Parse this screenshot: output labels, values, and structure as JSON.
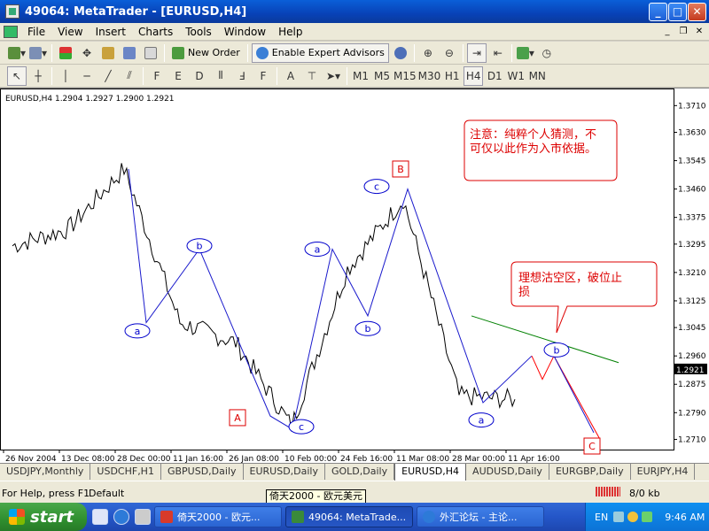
{
  "window": {
    "title": "49064: MetaTrader - [EURUSD,H4]"
  },
  "menu": [
    "File",
    "View",
    "Insert",
    "Charts",
    "Tools",
    "Window",
    "Help"
  ],
  "toolbar1": {
    "new_order": "New Order",
    "expert_advisors": "Enable Expert Advisors"
  },
  "toolbar2": {
    "timeframes": [
      "M1",
      "M5",
      "M15",
      "M30",
      "H1",
      "H4",
      "D1",
      "W1",
      "MN"
    ],
    "active_timeframe": "H4",
    "text_tool": "A"
  },
  "chart": {
    "header": "EURUSD,H4  1.2904 1.2927 1.2900 1.2921",
    "current_price": "1.2921",
    "price_ticks": [
      "1.3710",
      "1.3630",
      "1.3545",
      "1.3460",
      "1.3375",
      "1.3295",
      "1.3210",
      "1.3125",
      "1.3045",
      "1.2960",
      "1.2875",
      "1.2790",
      "1.2710"
    ],
    "time_ticks": [
      "26 Nov 2004",
      "13 Dec 08:00",
      "28 Dec 00:00",
      "11 Jan 16:00",
      "26 Jan 08:00",
      "10 Feb 00:00",
      "24 Feb 16:00",
      "11 Mar 08:00",
      "28 Mar 00:00",
      "11 Apr 16:00"
    ],
    "wave_labels": {
      "a": "a",
      "b": "b",
      "c": "c",
      "A": "A",
      "B": "B",
      "C": "C"
    },
    "note1": "注意：纯粹个人猜测，不可仅以此作为入市依据。",
    "note2": "理想沽空区，破位止损"
  },
  "chart_data": {
    "type": "line",
    "title": "EURUSD,H4",
    "ylim": [
      1.269,
      1.374
    ],
    "x": [
      "26 Nov 2004",
      "13 Dec 08:00",
      "28 Dec 00:00",
      "11 Jan 16:00",
      "26 Jan 08:00",
      "10 Feb 00:00",
      "24 Feb 16:00",
      "11 Mar 08:00",
      "28 Mar 00:00",
      "11 Apr 16:00"
    ],
    "series": [
      {
        "values": [
          1.329,
          1.334,
          1.352,
          1.306,
          1.3,
          1.275,
          1.322,
          1.343,
          1.284,
          1.283
        ]
      }
    ],
    "wave_points": [
      {
        "label": "a",
        "price": 1.306
      },
      {
        "label": "b",
        "price": 1.328
      },
      {
        "label": "A",
        "price": 1.278
      },
      {
        "label": "a",
        "price": 1.328
      },
      {
        "label": "b",
        "price": 1.308
      },
      {
        "label": "c",
        "price": 1.346
      },
      {
        "label": "B",
        "price": 1.346
      },
      {
        "label": "a",
        "price": 1.282
      },
      {
        "label": "b",
        "price": 1.296
      },
      {
        "label": "C",
        "price": 1.271
      }
    ],
    "current_price": 1.2921
  },
  "tabs": [
    "USDJPY,Monthly",
    "USDCHF,H1",
    "GBPUSD,Daily",
    "EURUSD,Daily",
    "GOLD,Daily",
    "EURUSD,H4",
    "AUDUSD,Daily",
    "EURGBP,Daily",
    "EURJPY,H4"
  ],
  "active_tab": "EURUSD,H4",
  "status": {
    "help": "For Help, press F1",
    "profile": "Default",
    "traffic": "8/0 kb"
  },
  "tooltip": "倚天2000 - 欧元美元",
  "taskbar": {
    "start": "start",
    "tasks": [
      "倚天2000 - 欧元...",
      "49064: MetaTrade...",
      "外汇论坛 - 主论..."
    ],
    "lang": "EN",
    "clock": "9:46 AM"
  },
  "colors": {
    "wave_line": "#1a1acc",
    "label_blue": "#0000cc",
    "label_red": "#dd0000",
    "trend_green": "#008000",
    "forecast_red": "#ff0000",
    "titlebar": "#0842b7"
  }
}
